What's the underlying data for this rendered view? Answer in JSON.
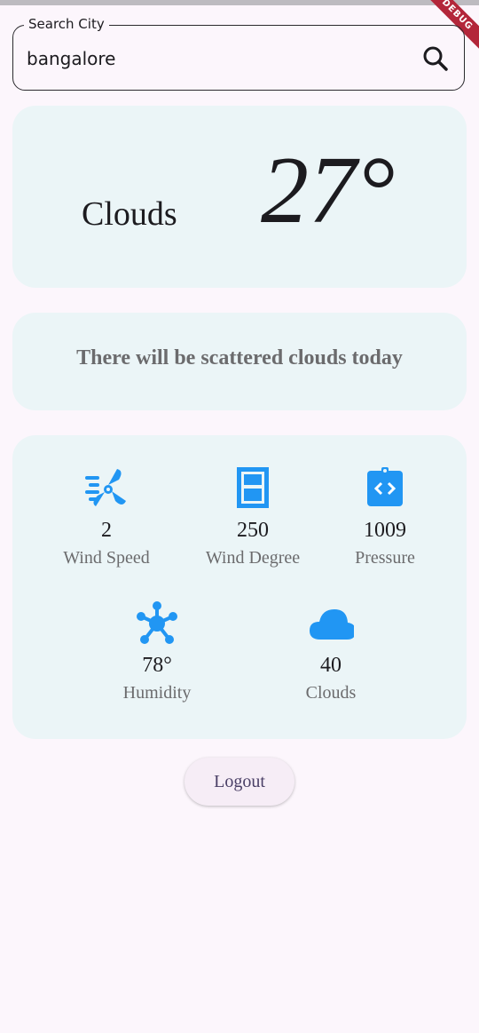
{
  "debug_banner": "DEBUG",
  "search": {
    "label": "Search City",
    "value": "bangalore"
  },
  "weather": {
    "condition": "Clouds",
    "temperature": "27°",
    "description": "There will be scattered clouds today"
  },
  "stats": [
    {
      "icon": "wind-fan-icon",
      "value": "2",
      "label": "Wind Speed"
    },
    {
      "icon": "door-sliding-icon",
      "value": "250",
      "label": "Wind Degree"
    },
    {
      "icon": "pressure-badge-icon",
      "value": "1009",
      "label": "Pressure"
    },
    {
      "icon": "molecule-hub-icon",
      "value": "78°",
      "label": "Humidity"
    },
    {
      "icon": "cloud-icon",
      "value": "40",
      "label": "Clouds"
    }
  ],
  "colors": {
    "accent": "#2196f3",
    "card": "#ebf5f7",
    "background": "#fcf6fc"
  },
  "actions": {
    "logout": "Logout"
  }
}
